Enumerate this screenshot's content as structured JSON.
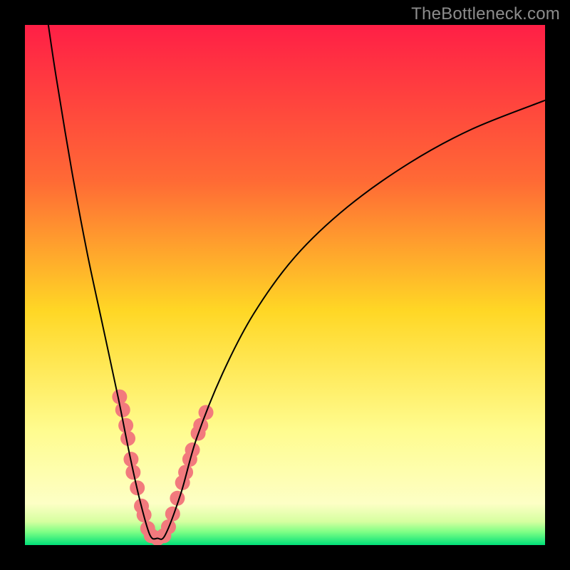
{
  "watermark": "TheBottleneck.com",
  "chart_data": {
    "type": "line",
    "title": "",
    "xlabel": "",
    "ylabel": "",
    "xlim": [
      0,
      100
    ],
    "ylim": [
      0,
      100
    ],
    "grid": false,
    "legend": false,
    "gradient_stops": [
      {
        "pos": 0.0,
        "color": "#ff1f46"
      },
      {
        "pos": 0.3,
        "color": "#ff6a35"
      },
      {
        "pos": 0.55,
        "color": "#ffd725"
      },
      {
        "pos": 0.78,
        "color": "#fffc8f"
      },
      {
        "pos": 0.92,
        "color": "#fdffc5"
      },
      {
        "pos": 0.955,
        "color": "#d6ffa0"
      },
      {
        "pos": 0.975,
        "color": "#7dff85"
      },
      {
        "pos": 1.0,
        "color": "#00e079"
      }
    ],
    "series": [
      {
        "name": "bottleneck-curve",
        "stroke": "#000000",
        "stroke_width": 2,
        "points": [
          {
            "x": 4.5,
            "y": 100.0
          },
          {
            "x": 6.0,
            "y": 90.0
          },
          {
            "x": 9.0,
            "y": 72.0
          },
          {
            "x": 12.0,
            "y": 56.0
          },
          {
            "x": 15.0,
            "y": 42.0
          },
          {
            "x": 18.0,
            "y": 28.0
          },
          {
            "x": 20.0,
            "y": 18.0
          },
          {
            "x": 22.0,
            "y": 9.0
          },
          {
            "x": 24.0,
            "y": 2.0
          },
          {
            "x": 25.5,
            "y": 1.3
          },
          {
            "x": 27.0,
            "y": 2.0
          },
          {
            "x": 30.0,
            "y": 10.0
          },
          {
            "x": 33.0,
            "y": 20.5
          },
          {
            "x": 38.0,
            "y": 33.0
          },
          {
            "x": 44.0,
            "y": 44.5
          },
          {
            "x": 52.0,
            "y": 55.5
          },
          {
            "x": 62.0,
            "y": 65.0
          },
          {
            "x": 74.0,
            "y": 73.5
          },
          {
            "x": 86.0,
            "y": 80.0
          },
          {
            "x": 100.0,
            "y": 85.5
          }
        ]
      },
      {
        "name": "marker-cluster",
        "stroke": "#f27a7d",
        "marker_fill": "#f27a7d",
        "marker_radius_px": 10.5,
        "points": [
          {
            "x": 18.2,
            "y": 28.5
          },
          {
            "x": 18.8,
            "y": 26.0
          },
          {
            "x": 19.4,
            "y": 23.0
          },
          {
            "x": 19.8,
            "y": 20.5
          },
          {
            "x": 20.4,
            "y": 16.5
          },
          {
            "x": 20.8,
            "y": 14.0
          },
          {
            "x": 21.6,
            "y": 11.0
          },
          {
            "x": 22.4,
            "y": 7.5
          },
          {
            "x": 22.9,
            "y": 5.8
          },
          {
            "x": 23.6,
            "y": 3.2
          },
          {
            "x": 24.3,
            "y": 1.8
          },
          {
            "x": 25.5,
            "y": 1.3
          },
          {
            "x": 26.7,
            "y": 1.8
          },
          {
            "x": 27.6,
            "y": 3.5
          },
          {
            "x": 28.4,
            "y": 6.0
          },
          {
            "x": 29.3,
            "y": 9.0
          },
          {
            "x": 30.3,
            "y": 12.0
          },
          {
            "x": 30.9,
            "y": 14.0
          },
          {
            "x": 31.7,
            "y": 16.5
          },
          {
            "x": 32.2,
            "y": 18.3
          },
          {
            "x": 33.3,
            "y": 21.5
          },
          {
            "x": 33.8,
            "y": 23.0
          },
          {
            "x": 34.8,
            "y": 25.5
          }
        ]
      }
    ],
    "annotations": []
  }
}
